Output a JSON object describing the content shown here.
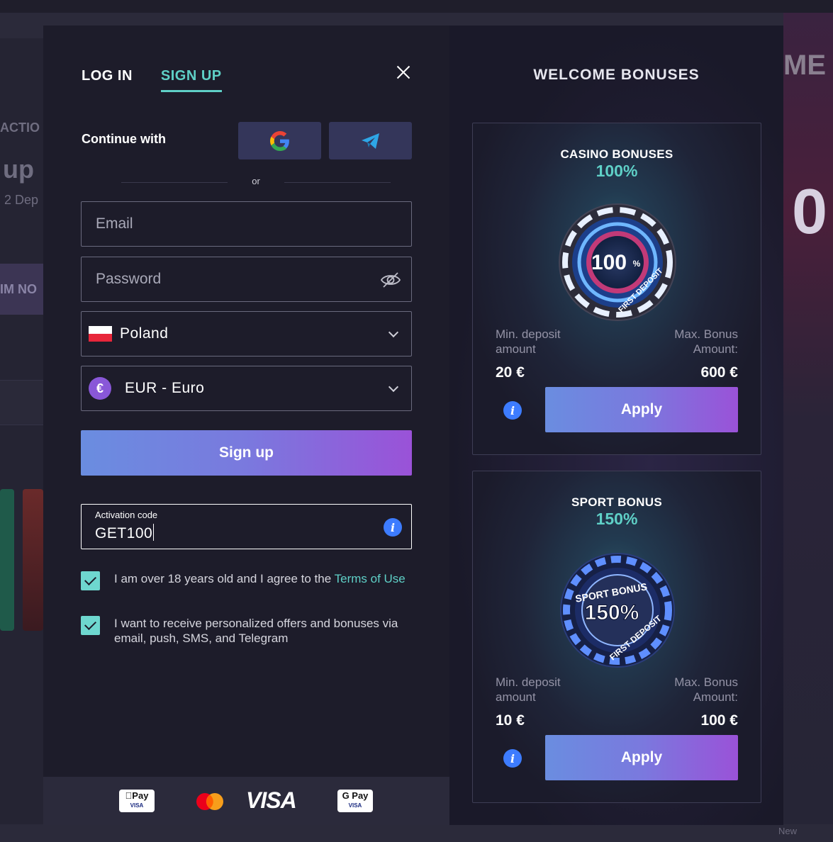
{
  "background": {
    "left_texts": [
      "ACTIO",
      "up",
      "2 Dep",
      "IM NO"
    ],
    "right_texts": [
      "ME",
      "0"
    ],
    "bottom_badge": "New"
  },
  "auth": {
    "tabs": [
      {
        "label": "LOG IN",
        "active": false
      },
      {
        "label": "SIGN UP",
        "active": true
      }
    ],
    "continue_with": "Continue with",
    "social": [
      "google-icon",
      "telegram-icon"
    ],
    "or": "or",
    "email_placeholder": "Email",
    "password_placeholder": "Password",
    "country": {
      "value": "Poland",
      "flag": "poland-flag"
    },
    "currency": {
      "value": "EUR - Euro",
      "symbol": "€"
    },
    "signup_label": "Sign up",
    "activation": {
      "label": "Activation code",
      "value": "GET100"
    },
    "consents": [
      {
        "text": "I am over 18 years old and I agree to the ",
        "link": "Terms of Use",
        "checked": true
      },
      {
        "text": "I want to receive personalized offers and bonuses via email, push, SMS, and Telegram",
        "checked": true
      }
    ],
    "payments": {
      "apple_pay": "Pay",
      "apple_pay_sub": "VISA",
      "mastercard": "mastercard-icon",
      "visa": "VISA",
      "google_pay": "G Pay",
      "google_pay_sub": "VISA"
    }
  },
  "bonuses": {
    "title": "WELCOME BONUSES",
    "cards": [
      {
        "title": "CASINO BONUSES",
        "percent": "100%",
        "chip_text": "100",
        "chip_sub": "FIRST DEPOSIT",
        "min_label": "Min. deposit amount",
        "min_value": "20 €",
        "max_label": "Max. Bonus Amount:",
        "max_value": "600 €",
        "apply": "Apply"
      },
      {
        "title": "SPORT BONUS",
        "percent": "150%",
        "chip_text": "150%",
        "chip_sub": "FIRST DEPOSIT",
        "chip_top": "SPORT BONUS",
        "min_label": "Min. deposit amount",
        "min_value": "10 €",
        "max_label": "Max. Bonus Amount:",
        "max_value": "100 €",
        "apply": "Apply"
      }
    ]
  },
  "colors": {
    "accent_teal": "#5fd0c7",
    "button_gradient_start": "#6a8de0",
    "button_gradient_end": "#9a52d8",
    "info_blue": "#3d7cff",
    "panel_bg": "#1d1c2a"
  }
}
